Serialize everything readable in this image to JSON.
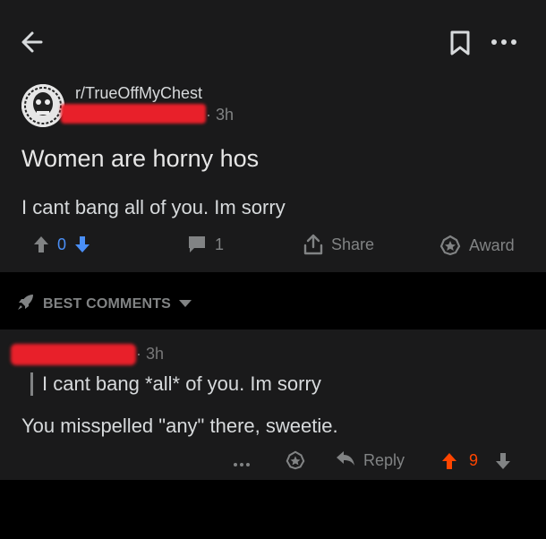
{
  "post": {
    "subreddit": "r/TrueOffMyChest",
    "time": "3h",
    "title": "Women are horny hos",
    "body": "I cant bang all of you. Im sorry",
    "score": "0",
    "comment_count": "1",
    "share_label": "Share",
    "award_label": "Award"
  },
  "sort": {
    "label": "BEST COMMENTS"
  },
  "comment": {
    "time": "3h",
    "quote": "I cant bang *all* of you. Im sorry",
    "text": "You misspelled \"any\" there, sweetie.",
    "reply_label": "Reply",
    "score": "9"
  },
  "icons": {
    "back": "arrow-left-icon",
    "save": "bookmark-icon",
    "more": "more-dots-icon",
    "upvote": "upvote-arrow-icon",
    "downvote": "downvote-arrow-icon",
    "comments": "comment-bubble-icon",
    "share": "share-icon",
    "award": "award-icon",
    "sort": "rocket-icon",
    "reply": "reply-arrow-icon"
  },
  "colors": {
    "background": "#000000",
    "card": "#1a1a1b",
    "text": "#d7dadc",
    "muted": "#818384",
    "downvote_active": "#4a8ff7",
    "upvote_active": "#ff4500",
    "redaction": "#e8202a"
  }
}
